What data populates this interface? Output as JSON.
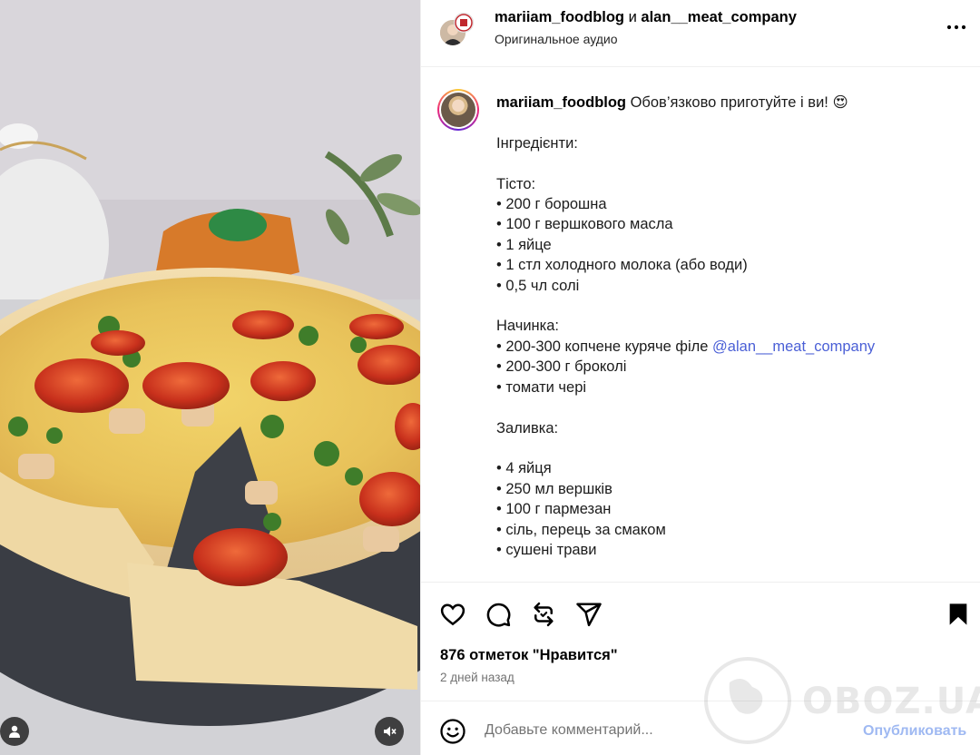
{
  "post": {
    "authors": {
      "primary": "mariiam_foodblog",
      "conjunction": "и",
      "secondary": "alan__meat_company"
    },
    "audio_label": "Оригинальное аудио",
    "caption": {
      "username": "mariiam_foodblog",
      "intro": " Обов’язково приготуйте і ви! 😍",
      "body_1": "\n\nІнгредієнти:\n\nТісто:\n• 200 г борошна\n• 100 г вершкового масла\n• 1 яйце\n• 1 стл холодного молока (або води)\n• 0,5 чл солі\n\nНачинка:\n• 200-300 копчене куряче філе ",
      "mention": "@alan__meat_company",
      "body_2": "\n• 200-300 г броколі\n• томати чері\n\nЗаливка:\n\n• 4 яйця\n• 250 мл вершків\n• 100 г пармезан\n• сіль, перець за смаком\n• сушені трави"
    },
    "likes_text": "876 отметок \"Нравится\"",
    "time_ago": "2 дней назад"
  },
  "comment": {
    "placeholder": "Добавьте комментарий...",
    "publish_label": "Опубликовать"
  },
  "watermark": {
    "text": "OBOZ.UA"
  },
  "icons": {
    "more": "more-horizontal-icon",
    "like": "heart-icon",
    "comment": "comment-bubble-icon",
    "repost": "repost-icon",
    "share": "paper-plane-icon",
    "save": "bookmark-icon",
    "emoji": "smiley-icon",
    "user": "user-tag-icon",
    "mute": "speaker-muted-icon"
  },
  "colors": {
    "mention": "#4a5fd6",
    "publish_disabled": "#9fb9f2",
    "muted_text": "#737373",
    "border": "#efefef"
  }
}
